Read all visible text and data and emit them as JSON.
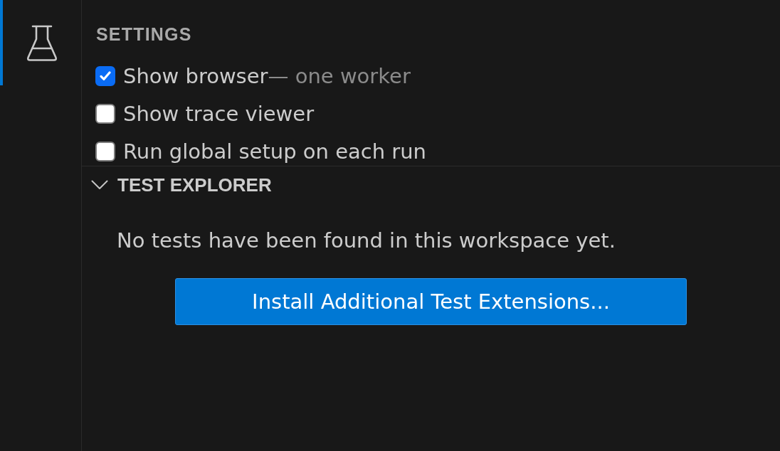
{
  "activity_bar": {
    "items": [
      {
        "selected": true
      }
    ]
  },
  "settings": {
    "title": "SETTINGS",
    "items": [
      {
        "label": "Show browser",
        "description": "— one worker",
        "checked": true
      },
      {
        "label": "Show trace viewer",
        "checked": false
      },
      {
        "label": "Run global setup on each run",
        "checked": false
      }
    ]
  },
  "test_explorer": {
    "title": "TEST EXPLORER",
    "expanded": true,
    "message": "No tests have been found in this workspace yet.",
    "button": "Install Additional Test Extensions..."
  }
}
